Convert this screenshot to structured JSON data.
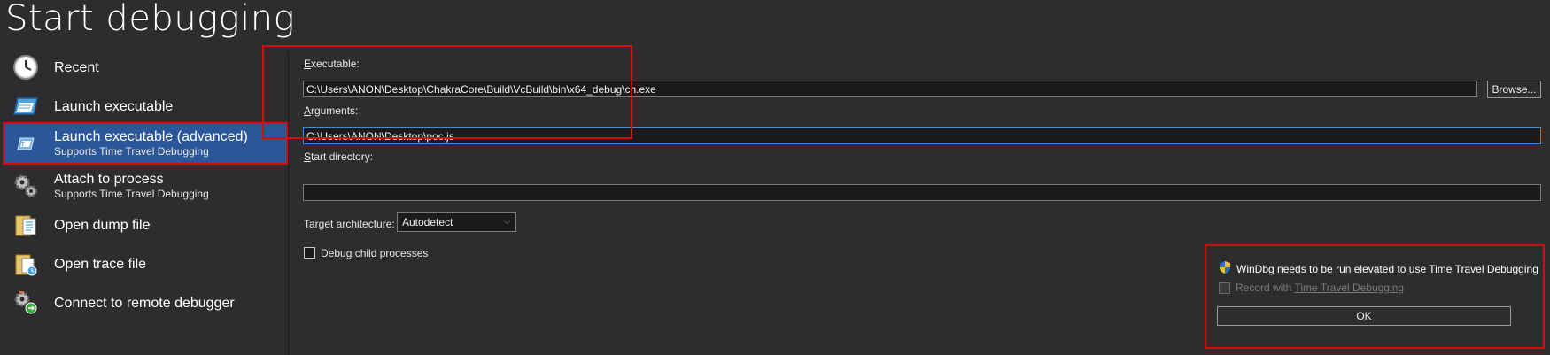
{
  "page": {
    "title": "Start debugging"
  },
  "sidebar": {
    "items": [
      {
        "label": "Recent",
        "sub": "",
        "icon": "clock-icon"
      },
      {
        "label": "Launch executable",
        "sub": "",
        "icon": "window-icon"
      },
      {
        "label": "Launch executable (advanced)",
        "sub": "Supports Time Travel Debugging",
        "icon": "window-advanced-icon"
      },
      {
        "label": "Attach to process",
        "sub": "Supports Time Travel Debugging",
        "icon": "gears-icon"
      },
      {
        "label": "Open dump file",
        "sub": "",
        "icon": "dump-file-icon"
      },
      {
        "label": "Open trace file",
        "sub": "",
        "icon": "trace-file-icon"
      },
      {
        "label": "Connect to remote debugger",
        "sub": "",
        "icon": "remote-debugger-icon"
      }
    ]
  },
  "form": {
    "executable": {
      "label_first": "E",
      "label_rest": "xecutable:",
      "value": "C:\\Users\\ANON\\Desktop\\ChakraCore\\Build\\VcBuild\\bin\\x64_debug\\ch.exe"
    },
    "browse_label": "Browse...",
    "arguments": {
      "label_first": "A",
      "label_rest": "rguments:",
      "value": "C:\\Users\\ANON\\Desktop\\poc.js"
    },
    "start_directory": {
      "label_first": "S",
      "label_rest": "tart directory:",
      "value": ""
    },
    "target_architecture": {
      "label": "Target architecture:",
      "selected": "Autodetect"
    },
    "debug_child": {
      "label": "Debug child processes",
      "checked": false
    }
  },
  "elevation": {
    "message": "WinDbg needs to be run elevated to use Time Travel Debugging",
    "record_prefix": "Record with ",
    "record_link": "Time Travel Debugging",
    "ok_label": "OK"
  },
  "colors": {
    "background": "#2d2d30",
    "accent": "#2b579a",
    "highlight_border": "#d01010",
    "focus_border": "#3f8fd8"
  }
}
